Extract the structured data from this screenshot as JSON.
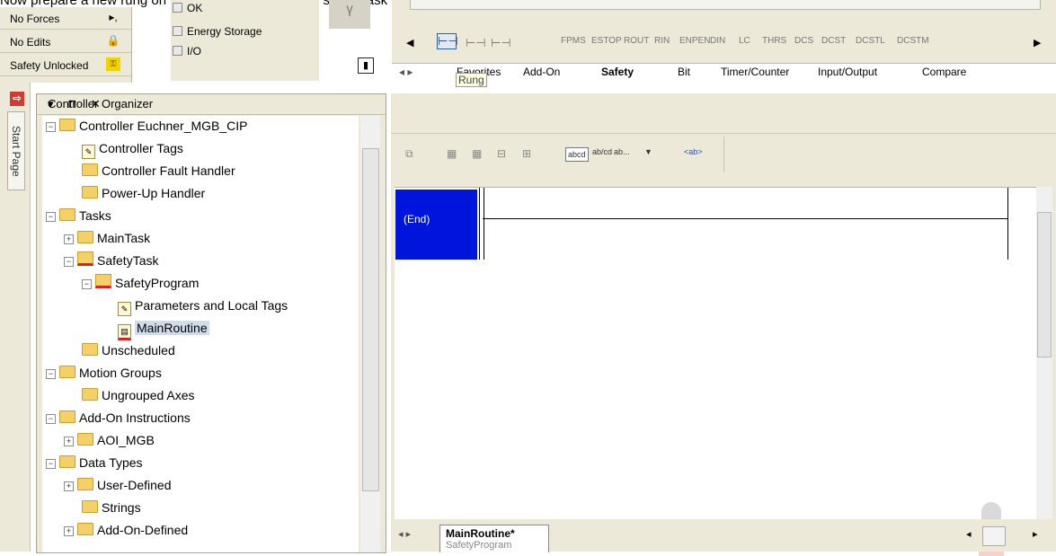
{
  "caption": "Now prepare a new rung on the ladder diagram in the safety task",
  "status": {
    "no_forces": "No Forces",
    "no_edits": "No Edits",
    "safety_unlocked": "Safety Unlocked"
  },
  "checks": {
    "ok": "OK",
    "energy_storage": "Energy Storage",
    "io": "I/O"
  },
  "instructions": [
    "FPMS",
    "ESTOP",
    "ROUT",
    "RIN",
    "ENPEN",
    "DIN",
    "LC",
    "THRS",
    "DCS",
    "DCST",
    "DCSTL",
    "DCSTM"
  ],
  "tabs": [
    "Favorites",
    "Add-On",
    "Safety",
    "Bit",
    "Timer/Counter",
    "Input/Output",
    "Compare"
  ],
  "tooltip": "Rung",
  "start_page": "Start Page",
  "organizer": {
    "title": "Controller Organizer",
    "controls": "▾ ⊓ ✕",
    "items": [
      "Controller Euchner_MGB_CIP",
      "Controller Tags",
      "Controller Fault Handler",
      "Power-Up Handler",
      "Tasks",
      "MainTask",
      "SafetyTask",
      "SafetyProgram",
      "Parameters and Local Tags",
      "MainRoutine",
      "Unscheduled",
      "Motion Groups",
      "Ungrouped Axes",
      "Add-On Instructions",
      "AOI_MGB",
      "Data Types",
      "User-Defined",
      "Strings",
      "Add-On-Defined"
    ]
  },
  "editor": {
    "toolbar": [
      "abcd",
      "ab/cd",
      "ab...",
      "<ab>"
    ],
    "end_label": "(End)",
    "routine_tab": "MainRoutine*",
    "routine_sub": "SafetyProgram"
  }
}
